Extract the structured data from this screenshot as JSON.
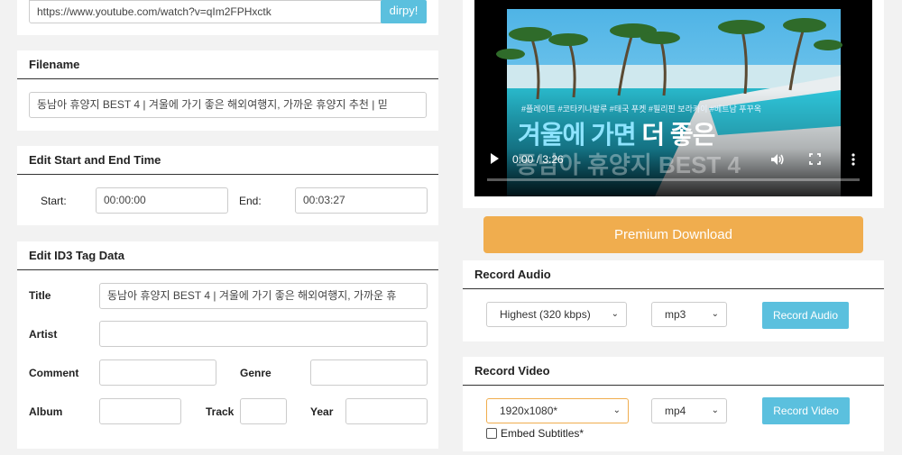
{
  "url_bar": {
    "value": "https://www.youtube.com/watch?v=qIm2FPHxctk",
    "button": "dirpy!"
  },
  "filename": {
    "heading": "Filename",
    "value": "동남아 휴양지 BEST 4 | 겨울에 가기 좋은 해외여행지, 가까운 휴양지 추천 | 믿"
  },
  "time": {
    "heading": "Edit Start and End Time",
    "start_label": "Start:",
    "start_value": "00:00:00",
    "end_label": "End:",
    "end_value": "00:03:27"
  },
  "id3": {
    "heading": "Edit ID3 Tag Data",
    "title_label": "Title",
    "title_value": "동남아 휴양지 BEST 4 | 겨울에 가기 좋은 해외여행지, 가까운 휴",
    "artist_label": "Artist",
    "comment_label": "Comment",
    "genre_label": "Genre",
    "album_label": "Album",
    "track_label": "Track",
    "year_label": "Year"
  },
  "video": {
    "caption_small": "#플레이트 #코타키나발루 #태국 푸켓 #필리핀 보라카이 #베트남 푸꾸옥",
    "caption_big_a": "겨울에 가면",
    "caption_big_b": "더 좋은",
    "caption_big_c": "동남아 휴양지 BEST 4",
    "time": "0:00 / 3:26",
    "progress": 0.0
  },
  "premium": {
    "label": "Premium Download",
    "color": "#f0ad4e"
  },
  "audio": {
    "heading": "Record Audio",
    "quality": "Highest (320 kbps)",
    "format": "mp3",
    "button": "Record Audio"
  },
  "video_rec": {
    "heading": "Record Video",
    "resolution": "1920x1080*",
    "format": "mp4",
    "button": "Record Video",
    "subtitles_label": "Embed Subtitles*"
  }
}
